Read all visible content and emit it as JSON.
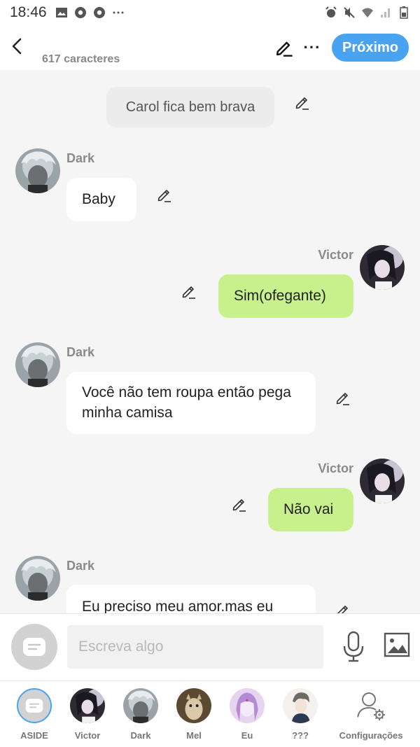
{
  "status_bar": {
    "time": "18:46"
  },
  "header": {
    "char_count": "617 caracteres",
    "next_label": "Próximo"
  },
  "chat": {
    "narration": "Carol fica bem brava",
    "messages": [
      {
        "speaker": "Dark",
        "text": "Baby",
        "side": "left"
      },
      {
        "speaker": "Victor",
        "text": "Sim(ofegante)",
        "side": "right"
      },
      {
        "speaker": "Dark",
        "text": "Você não tem roupa então pega minha camisa",
        "side": "left"
      },
      {
        "speaker": "Victor",
        "text": "Não vai",
        "side": "right"
      },
      {
        "speaker": "Dark",
        "text": "Eu preciso meu amor.mas eu",
        "side": "left"
      }
    ]
  },
  "input": {
    "placeholder": "Escreva algo"
  },
  "characters": [
    {
      "label": "ASIDE",
      "icon": "chat-bubble-icon"
    },
    {
      "label": "Victor"
    },
    {
      "label": "Dark"
    },
    {
      "label": "Mel"
    },
    {
      "label": "Eu"
    },
    {
      "label": "???"
    },
    {
      "label": "Configurações",
      "icon": "person-gear-icon"
    }
  ],
  "colors": {
    "accent": "#4aa3f0",
    "right_bubble": "#c8f08c",
    "left_bubble": "#ffffff",
    "background": "#f5f5f5"
  }
}
